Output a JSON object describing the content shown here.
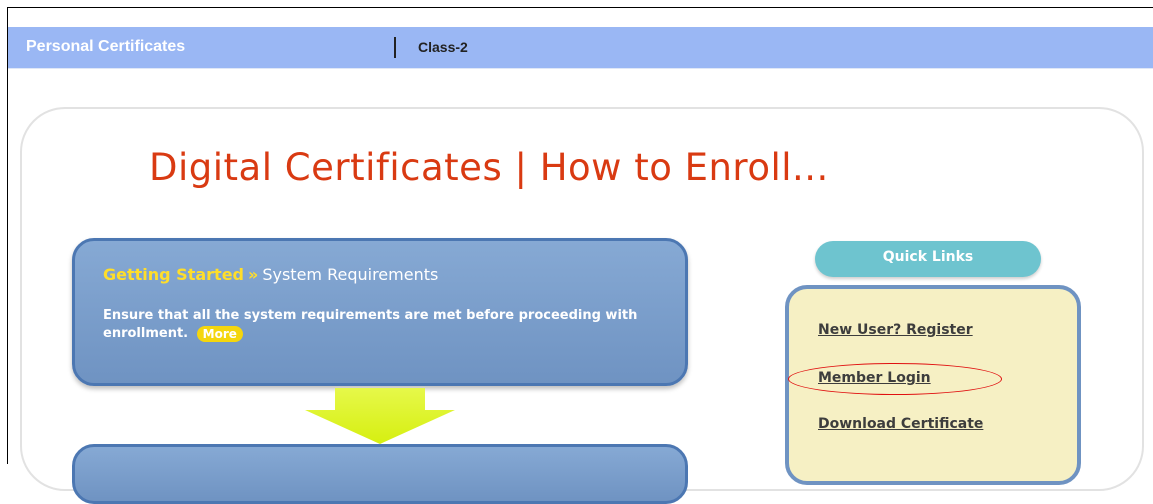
{
  "topbar": {
    "tab_personal": "Personal Certificates",
    "tab_class": "Class-2"
  },
  "main": {
    "title": "Digital Certificates | How to Enroll...",
    "getting_started": {
      "label": "Getting Started",
      "arrows": "»",
      "sublabel": "System Requirements",
      "text": "Ensure that all the system requirements are met before proceeding with enrollment.",
      "more_label": "More"
    }
  },
  "quick_links": {
    "title": "Quick Links",
    "items": [
      {
        "label": "New User? Register"
      },
      {
        "label": "Member Login"
      },
      {
        "label": "Download Certificate"
      }
    ]
  },
  "colors": {
    "title": "#d93a12",
    "topbar": "#9ab7f4",
    "box_blue": "#6f93c2",
    "accent_yellow": "#ffde2a",
    "quick_links_bg": "#f6f0c4",
    "highlight_circle": "#e01010"
  }
}
